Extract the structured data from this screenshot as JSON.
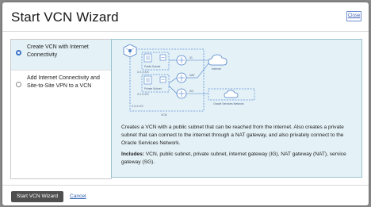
{
  "dialog": {
    "title": "Start VCN Wizard",
    "close_label": "Close"
  },
  "options": [
    {
      "label": "Create VCN with Internet Connectivity",
      "selected": true
    },
    {
      "label": "Add Internet Connectivity and Site-to-Site VPN to a VCN",
      "selected": false
    }
  ],
  "diagram": {
    "public_subnet": "Public Subnet",
    "private_subnet": "Private Subnet",
    "ig": "IG",
    "nat": "NAT",
    "sg": "SG",
    "internet": "Internet",
    "osn": "Oracle Services Network",
    "vcn": "VCN",
    "cidr_a": "X.X.X.X/X",
    "cidr_b": "X.X.X.X/X",
    "cidr_c": "X.X.X.X/X"
  },
  "detail": {
    "description": "Creates a VCN with a public subnet that can be reached from the internet. Also creates a private subnet that can connect to the internet through a NAT gateway, and also privately connect to the Oracle Services Network.",
    "includes_label": "Includes:",
    "includes_text": " VCN, public subnet, private subnet, internet gateway (IG), NAT gateway (NAT), service gateway (SG)."
  },
  "footer": {
    "start_button": "Start VCN Wizard",
    "cancel_link": "Cancel"
  },
  "colors": {
    "selected_bg": "#e4f1f7",
    "accent": "#3b73c8",
    "primary_button": "#4f4f4f",
    "link": "#2a5db0"
  }
}
